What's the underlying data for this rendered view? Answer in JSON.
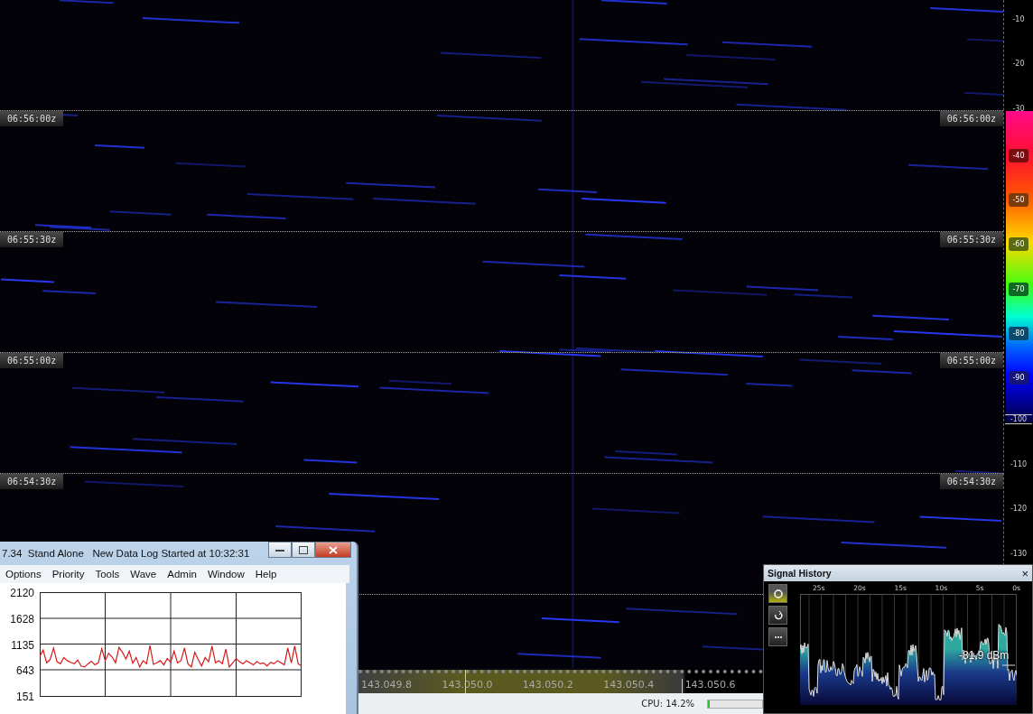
{
  "waterfall": {
    "time_markers": [
      {
        "left_label": "06:56:00z",
        "right_label": "06:56:00z"
      },
      {
        "left_label": "06:55:30z",
        "right_label": "06:55:30z"
      },
      {
        "left_label": "06:55:00z",
        "right_label": "06:55:00z"
      },
      {
        "left_label": "06:54:30z",
        "right_label": "06:54:30z"
      }
    ]
  },
  "scale": {
    "ticks": [
      {
        "label": "-10",
        "kind": "plain"
      },
      {
        "label": "-20",
        "kind": "plain"
      },
      {
        "label": "-30",
        "kind": "plain"
      },
      {
        "label": "-40",
        "kind": "boxed"
      },
      {
        "label": "-50",
        "kind": "boxed"
      },
      {
        "label": "-60",
        "kind": "boxed"
      },
      {
        "label": "-70",
        "kind": "boxed"
      },
      {
        "label": "-80",
        "kind": "boxed"
      },
      {
        "label": "-90",
        "kind": "boxed"
      },
      {
        "label": "-100",
        "kind": "line"
      },
      {
        "label": "-110",
        "kind": "plain"
      },
      {
        "label": "-120",
        "kind": "plain"
      },
      {
        "label": "-130",
        "kind": "plain"
      }
    ]
  },
  "frequency_ruler": {
    "labels": [
      "143.049.8",
      "143.050.0",
      "143.050.2",
      "143.050.4",
      "143.050.6"
    ]
  },
  "status_bar": {
    "cpu": "CPU: 14.2%",
    "cpu_meter": {
      "level": 0.04
    }
  },
  "log_window": {
    "title": "7.34  Stand Alone   New Data Log Started at 10:32:31",
    "menu": [
      "Options",
      "Priority",
      "Tools",
      "Wave",
      "Admin",
      "Window",
      "Help"
    ],
    "chart_data": {
      "type": "line",
      "grid": true,
      "ylim": [
        151,
        2120
      ],
      "yticks": [
        151,
        643,
        1135,
        1628,
        2120
      ],
      "series": [
        {
          "color": "#d81818",
          "values": [
            900,
            1020,
            780,
            840,
            1060,
            800,
            760,
            880,
            820,
            790,
            760,
            830,
            720,
            700,
            760,
            810,
            740,
            780,
            1050,
            820,
            960,
            890,
            780,
            1070,
            980,
            850,
            1000,
            770,
            880,
            700,
            820,
            760,
            1110,
            750,
            780,
            820,
            740,
            860,
            790,
            1000,
            780,
            820,
            1060,
            760,
            700,
            980,
            840,
            720,
            880,
            800,
            1100,
            780,
            820,
            760,
            1040,
            700,
            780,
            860,
            800,
            760,
            820,
            780,
            740,
            800,
            760,
            780,
            720,
            790,
            760,
            820,
            780,
            740,
            1060,
            780,
            1100,
            760,
            720
          ]
        }
      ]
    }
  },
  "signal_history": {
    "title": "Signal History",
    "close": "×",
    "buttons": [
      {
        "kind": "circle",
        "selected": true
      },
      {
        "kind": "refresh",
        "selected": false
      },
      {
        "kind": "more",
        "selected": false
      }
    ],
    "time_ticks": [
      "25s",
      "20s",
      "15s",
      "10s",
      "5s",
      "0s"
    ],
    "reading": "-81.9 dBm"
  }
}
